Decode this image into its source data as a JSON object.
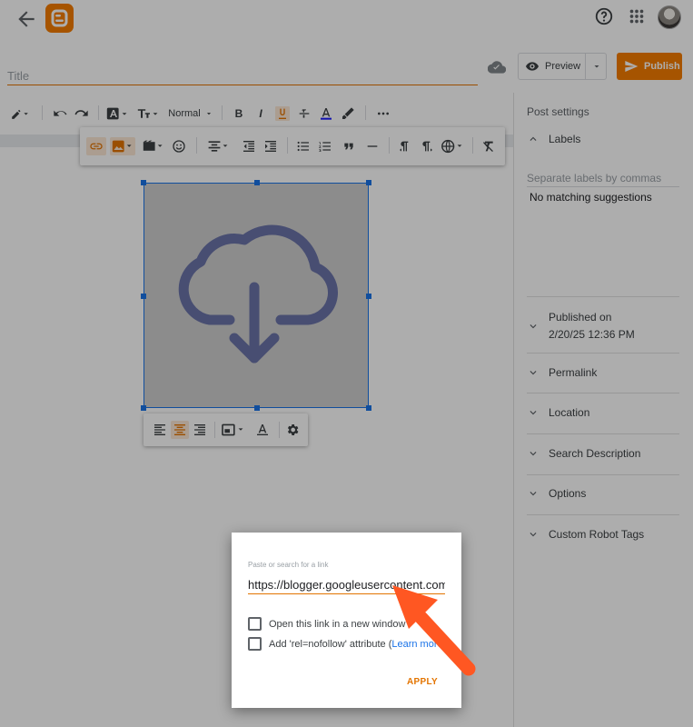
{
  "header": {
    "back_icon": "arrow-left-icon",
    "logo_icon": "blogger-logo-icon",
    "help_icon": "help-circle-icon",
    "apps_icon": "apps-grid-icon",
    "account_icon": "avatar"
  },
  "editor_header": {
    "title_placeholder": "Title",
    "preview_label": "Preview",
    "publish_label": "Publish",
    "accent_color": "#f57d00"
  },
  "toolbar": {
    "paragraph_style": "Normal",
    "more_icon": "more-horiz-icon"
  },
  "image": {
    "placeholder_icon": "cloud-download-icon"
  },
  "post_settings": {
    "title": "Post settings",
    "labels": {
      "heading": "Labels",
      "placeholder": "Separate labels by commas",
      "suggestions": "No matching suggestions"
    },
    "published_on": {
      "heading": "Published on",
      "value": "2/20/25 12:36 PM"
    },
    "sections": [
      "Permalink",
      "Location",
      "Search Description",
      "Options",
      "Custom Robot Tags"
    ]
  },
  "link_dialog": {
    "label": "Paste or search for a link",
    "url_value": "https://blogger.googleusercontent.com",
    "new_window_label": "Open this link in a new window",
    "nofollow_label": "Add 'rel=nofollow' attribute (",
    "learn_more": "Learn more",
    "apply_label": "APPLY"
  },
  "annotation": {
    "arrow_color": "#ff5722"
  }
}
